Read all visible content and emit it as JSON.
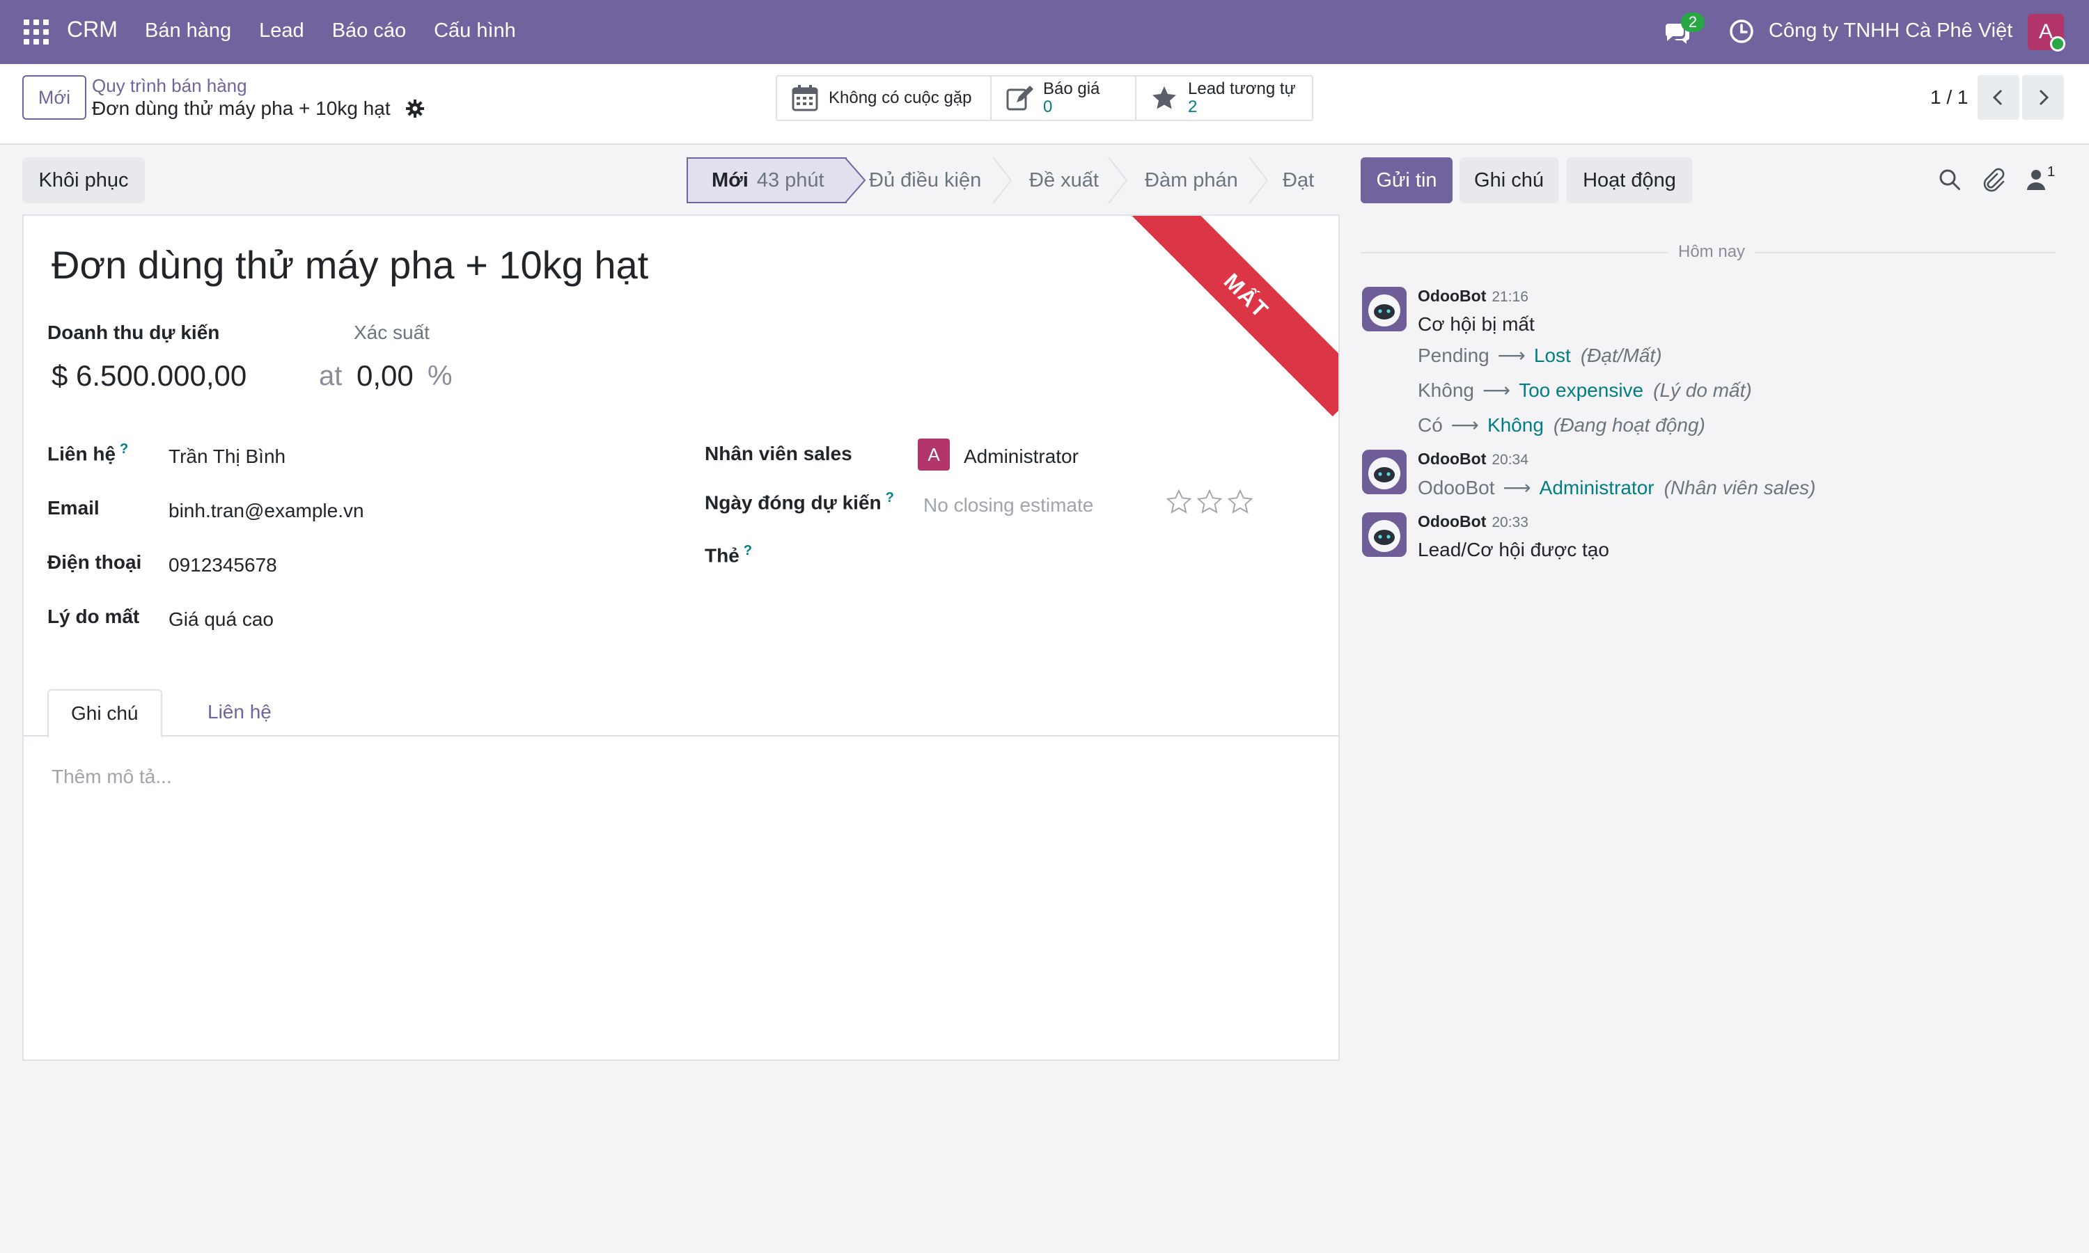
{
  "navbar": {
    "brand": "CRM",
    "menu": [
      "Bán hàng",
      "Lead",
      "Báo cáo",
      "Cấu hình"
    ],
    "chat_badge": "2",
    "company": "Công ty TNHH Cà Phê Việt",
    "user_initial": "A"
  },
  "control": {
    "new_button": "Mới",
    "breadcrumb_parent": "Quy trình bán hàng",
    "breadcrumb_current": "Đơn dùng thử máy pha + 10kg hạt",
    "smart_buttons": {
      "meetings": "Không có cuộc gặp",
      "quotes_label": "Báo giá",
      "quotes_value": "0",
      "similar_label": "Lead tương tự",
      "similar_value": "2"
    },
    "pager": "1 / 1"
  },
  "statusbar": {
    "restore_button": "Khôi phục",
    "stages": [
      "Mới",
      "Đủ điều kiện",
      "Đề xuất",
      "Đàm phán",
      "Đạt"
    ],
    "active_time": "43 phút"
  },
  "form": {
    "ribbon": "MẤT",
    "title": "Đơn dùng thử máy pha + 10kg hạt",
    "revenue_label": "Doanh thu dự kiến",
    "revenue_value": "$ 6.500.000,00",
    "probability_label": "Xác suất",
    "probability_at": "at",
    "probability_value": "0,00",
    "probability_unit": "%",
    "help_mark": "?",
    "fields": {
      "contact_label": "Liên hệ",
      "contact_value": "Trần Thị Bình",
      "email_label": "Email",
      "email_value": "binh.tran@example.vn",
      "phone_label": "Điện thoại",
      "phone_value": "0912345678",
      "lost_reason_label": "Lý do mất",
      "lost_reason_value": "Giá quá cao",
      "salesperson_label": "Nhân viên sales",
      "salesperson_initial": "A",
      "salesperson_value": "Administrator",
      "close_date_label": "Ngày đóng dự kiến",
      "close_date_placeholder": "No closing estimate",
      "tags_label": "Thẻ",
      "priority_stars": 0
    },
    "tabs": [
      "Ghi chú",
      "Liên hệ"
    ],
    "description_placeholder": "Thêm mô tả..."
  },
  "chatter": {
    "send_button": "Gửi tin",
    "note_button": "Ghi chú",
    "activity_button": "Hoạt động",
    "followers_count": "1",
    "date_separator": "Hôm nay",
    "messages": [
      {
        "author": "OdooBot",
        "time": "21:16",
        "body": "Cơ hội bị mất",
        "tracking": [
          {
            "old": "Pending",
            "new": "Lost",
            "field": "(Đạt/Mất)"
          },
          {
            "old": "Không",
            "new": "Too expensive",
            "field": "(Lý do mất)"
          },
          {
            "old": "Có",
            "new": "Không",
            "field": "(Đang hoạt động)"
          }
        ]
      },
      {
        "author": "OdooBot",
        "time": "20:34",
        "tracking": [
          {
            "old": "OdooBot",
            "new": "Administrator",
            "field": "(Nhân viên sales)"
          }
        ]
      },
      {
        "author": "OdooBot",
        "time": "20:33",
        "body": "Lead/Cơ hội được tạo"
      }
    ]
  },
  "colors": {
    "brand": "#71639e",
    "link": "#017e84",
    "ribbon": "#dc3545",
    "avatar": "#b3366b"
  }
}
